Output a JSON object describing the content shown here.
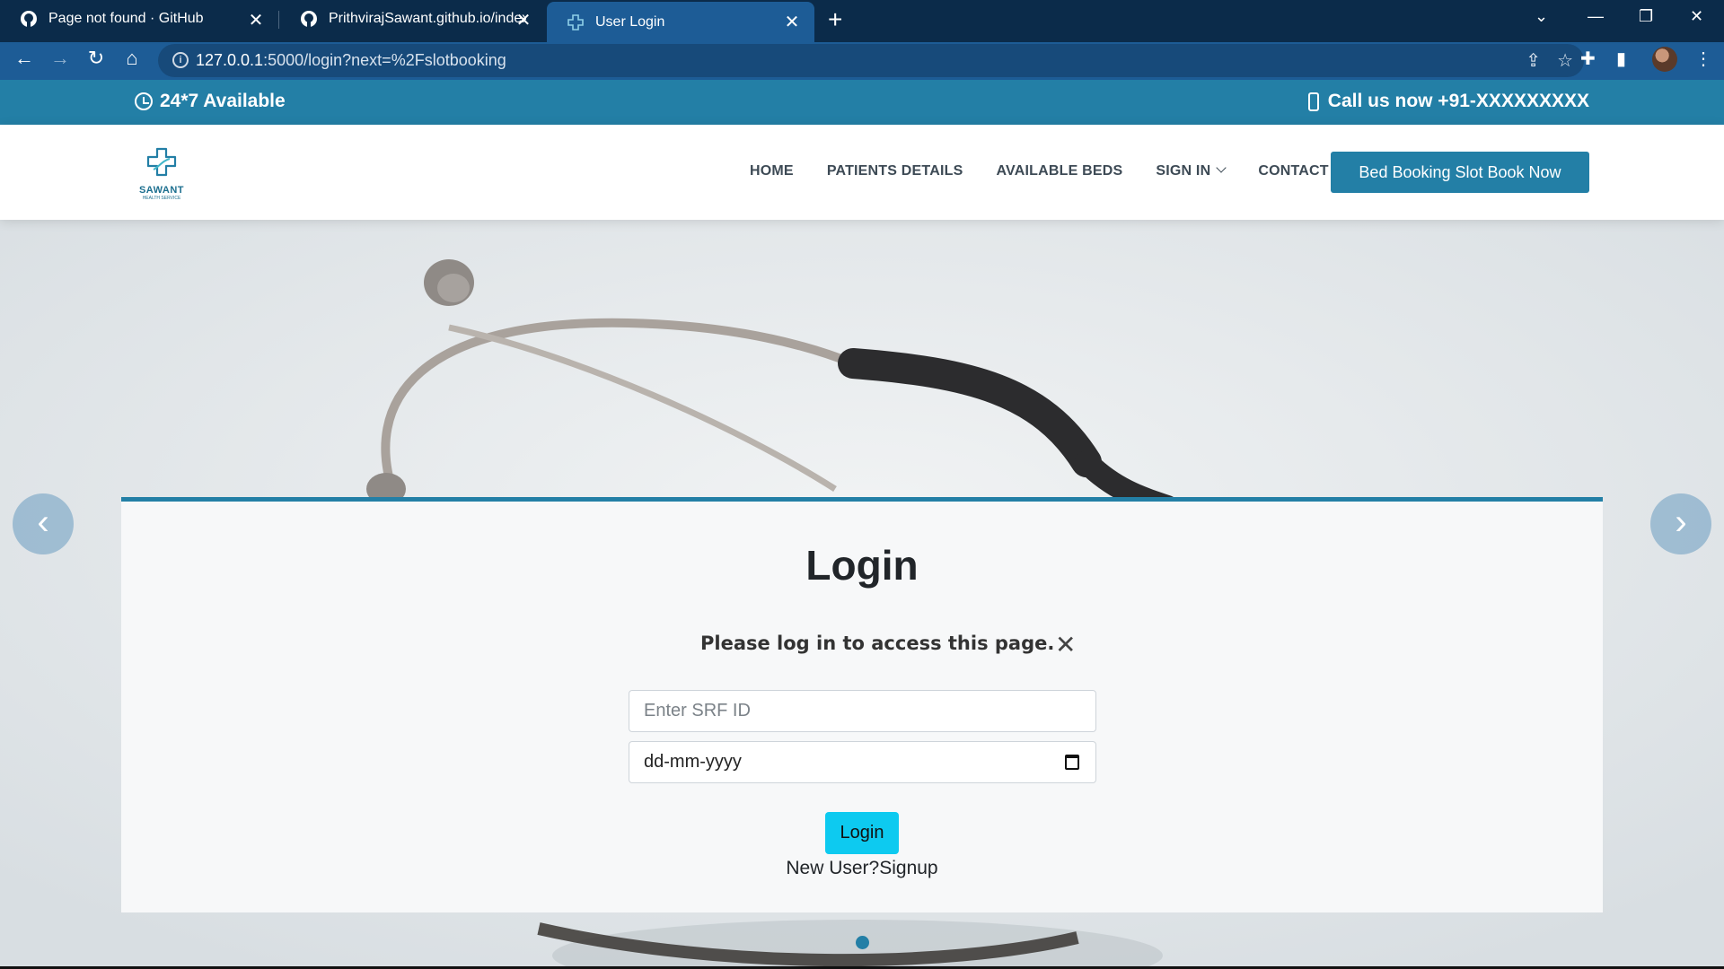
{
  "browser": {
    "tabs": [
      {
        "title": "Page not found · GitHub",
        "icon": "github-icon"
      },
      {
        "title": "PrithvirajSawant.github.io/index.h",
        "icon": "github-icon"
      },
      {
        "title": "User Login",
        "icon": "site-logo-icon"
      }
    ],
    "active_tab_index": 2,
    "url_host": "127.0.0.1",
    "url_rest": ":5000/login?next=%2Fslotbooking"
  },
  "site": {
    "topbar": {
      "availability": "24*7 Available",
      "call": "Call us now +91-XXXXXXXXX"
    },
    "logo": {
      "name": "SAWANT",
      "sub": "HEALTH SERVICE"
    },
    "nav": {
      "home": "HOME",
      "patients": "PATIENTS DETAILS",
      "beds": "AVAILABLE BEDS",
      "signin": "SIGN IN",
      "contact": "CONTACT",
      "cta": "Bed Booking Slot Book Now"
    },
    "colors": {
      "primary": "#237fa6",
      "login_button": "#0dcaf0",
      "browser_frame": "#0b2b4a"
    }
  },
  "login": {
    "title": "Login",
    "alert": "Please log in to access this page.",
    "srf_placeholder": "Enter  SRF ID",
    "date_placeholder": "dd-mm-yyyy",
    "button": "Login",
    "signup_text": "New User?Signup"
  }
}
